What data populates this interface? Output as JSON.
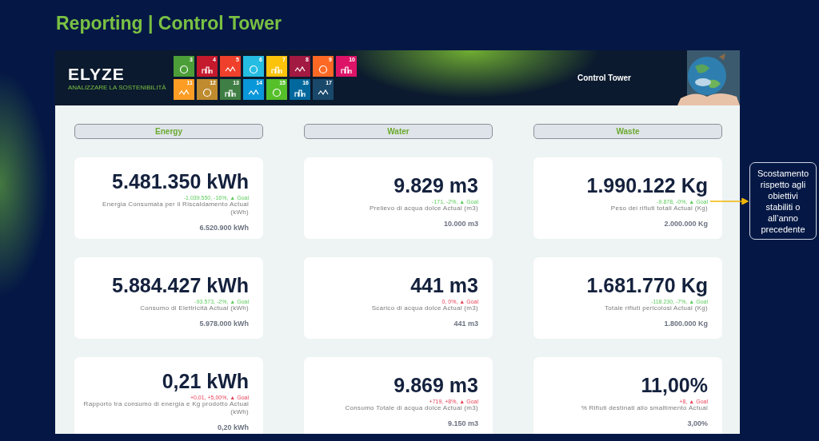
{
  "page_title": "Reporting | Control Tower",
  "header": {
    "logo": "ELYZE",
    "tagline": "ANALIZZARE LA SOSTENIBILITÀ",
    "title": "Control Tower",
    "sdg_tiles": [
      {
        "number": "3",
        "color": "#4c9f38"
      },
      {
        "number": "4",
        "color": "#c5192d"
      },
      {
        "number": "5",
        "color": "#ef402b"
      },
      {
        "number": "6",
        "color": "#26bde2"
      },
      {
        "number": "7",
        "color": "#fcc30b"
      },
      {
        "number": "8",
        "color": "#a21942"
      },
      {
        "number": "9",
        "color": "#fd6925"
      },
      {
        "number": "10",
        "color": "#dd1367"
      },
      {
        "number": "11",
        "color": "#fd9d24"
      },
      {
        "number": "12",
        "color": "#bf8b2e"
      },
      {
        "number": "13",
        "color": "#3f7e44"
      },
      {
        "number": "14",
        "color": "#0a97d9"
      },
      {
        "number": "15",
        "color": "#56c02b"
      },
      {
        "number": "16",
        "color": "#00689d"
      },
      {
        "number": "17",
        "color": "#19486a"
      }
    ]
  },
  "columns": [
    {
      "heading": "Energy",
      "cards": [
        {
          "value": "5.481.350 kWh",
          "delta": "-1.039.550, -16%, ▲ Goal",
          "color": "#5ccb5c",
          "label": "Energia Consumata per il Riscaldamento Actual (kWh)",
          "target": "6.520.900 kWh"
        },
        {
          "value": "5.884.427 kWh",
          "delta": "-93.573, -2%, ▲ Goal",
          "color": "#5ccb5c",
          "label": "Consumo di Elettricità Actual (kWh)",
          "target": "5.978.000 kWh"
        },
        {
          "value": "0,21 kWh",
          "delta": "+0,01, +5,00%, ▲ Goal",
          "color": "#e8435a",
          "label": "Rapporto tra consumo di energia e Kg prodotto Actual (kWh)",
          "target": "0,20 kWh"
        }
      ]
    },
    {
      "heading": "Water",
      "cards": [
        {
          "value": "9.829 m3",
          "delta": "-171, -2%, ▲ Goal",
          "color": "#5ccb5c",
          "label": "Prelievo di acqua dolce Actual (m3)",
          "target": "10.000 m3"
        },
        {
          "value": "441 m3",
          "delta": "0, 0%, ▲ Goal",
          "color": "#e8435a",
          "label": "Scarico di acqua dolce Actual (m3)",
          "target": "441 m3"
        },
        {
          "value": "9.869 m3",
          "delta": "+719, +8%, ▲ Goal",
          "color": "#e8435a",
          "label": "Consumo Totale di acqua dolce Actual (m3)",
          "target": "9.150 m3"
        }
      ]
    },
    {
      "heading": "Waste",
      "cards": [
        {
          "value": "1.990.122 Kg",
          "delta": "-9.878, -0%, ▲ Goal",
          "color": "#5ccb5c",
          "label": "Peso dei rifiuti totali Actual (Kg)",
          "target": "2.000.000 Kg"
        },
        {
          "value": "1.681.770 Kg",
          "delta": "-118.230, -7%, ▲ Goal",
          "color": "#5ccb5c",
          "label": "Totale rifiuti pericolosi Actual (Kg)",
          "target": "1.800.000 Kg"
        },
        {
          "value": "11,00%",
          "delta": "+8, ▲ Goal",
          "color": "#e8435a",
          "label": "% Rifiuti destinati allo smaltimento Actual",
          "target": "3,00%"
        }
      ]
    }
  ],
  "callout": {
    "text": "Scostamento rispetto agli obiettivi stabiliti o all’anno precedente"
  }
}
